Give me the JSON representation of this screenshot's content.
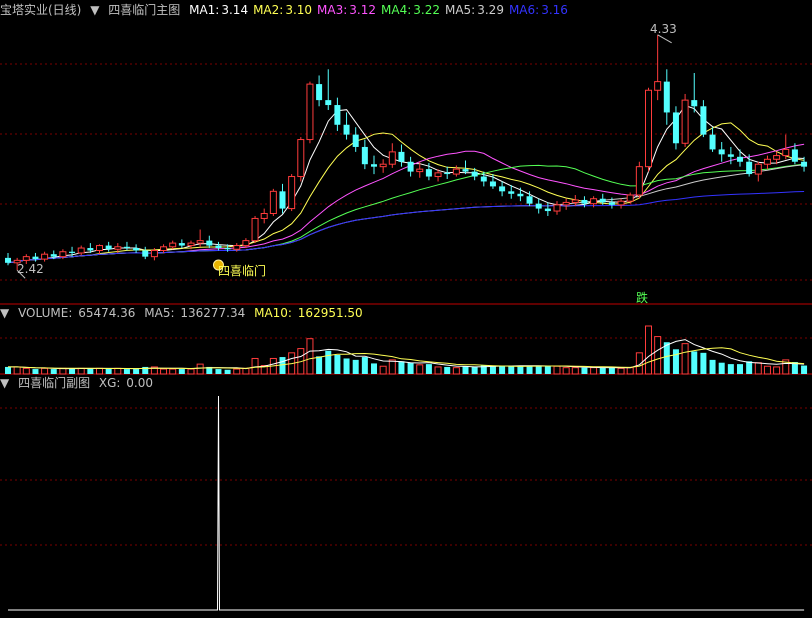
{
  "main_header": {
    "stock": "宝塔实业(日线)",
    "indicator": "四喜临门主图",
    "ma": [
      {
        "label": "MA1:",
        "value": "3.14",
        "color": "#ffffff"
      },
      {
        "label": "MA2:",
        "value": "3.10",
        "color": "#ffff54"
      },
      {
        "label": "MA3:",
        "value": "3.12",
        "color": "#ff54ff"
      },
      {
        "label": "MA4:",
        "value": "3.22",
        "color": "#54ff54"
      },
      {
        "label": "MA5:",
        "value": "3.29",
        "color": "#cccccc"
      },
      {
        "label": "MA6:",
        "value": "3.16",
        "color": "#3333ff"
      }
    ]
  },
  "volume_header": {
    "title": "VOLUME:",
    "value": "65474.36",
    "ma5_label": "MA5:",
    "ma5_value": "136277.34",
    "ma10_label": "MA10:",
    "ma10_value": "162951.50"
  },
  "sub_header": {
    "title": "四喜临门副图",
    "xg_label": "XG:",
    "xg_value": "0.00"
  },
  "annotations": {
    "high_label": "4.33",
    "low_label": "2.42",
    "signal_label": "四喜临门",
    "drop_label": "跌"
  },
  "colors": {
    "up": "#ff3c3c",
    "down": "#54ffff",
    "grid": "#7a0000",
    "separator": "#c00000",
    "text": "#c0c0c0",
    "ma1": "#ffffff",
    "ma2": "#ffff54",
    "ma3": "#ff54ff",
    "ma4": "#54ff54",
    "ma5": "#cccccc",
    "ma6": "#3333ff"
  },
  "chart_data": [
    {
      "type": "candlestick",
      "title": "四喜临门主图",
      "ylim": [
        2.3,
        4.45
      ],
      "max_high": 4.33,
      "min_low": 2.42,
      "ohlc": [
        [
          2.52,
          2.56,
          2.46,
          2.48
        ],
        [
          2.48,
          2.52,
          2.42,
          2.5
        ],
        [
          2.5,
          2.55,
          2.47,
          2.53
        ],
        [
          2.53,
          2.56,
          2.49,
          2.51
        ],
        [
          2.51,
          2.57,
          2.49,
          2.55
        ],
        [
          2.55,
          2.58,
          2.51,
          2.53
        ],
        [
          2.53,
          2.59,
          2.51,
          2.57
        ],
        [
          2.57,
          2.61,
          2.53,
          2.56
        ],
        [
          2.56,
          2.62,
          2.54,
          2.6
        ],
        [
          2.6,
          2.64,
          2.56,
          2.58
        ],
        [
          2.58,
          2.63,
          2.55,
          2.62
        ],
        [
          2.62,
          2.65,
          2.57,
          2.59
        ],
        [
          2.59,
          2.64,
          2.56,
          2.61
        ],
        [
          2.61,
          2.65,
          2.58,
          2.6
        ],
        [
          2.6,
          2.63,
          2.56,
          2.58
        ],
        [
          2.58,
          2.61,
          2.51,
          2.53
        ],
        [
          2.53,
          2.6,
          2.5,
          2.58
        ],
        [
          2.58,
          2.63,
          2.56,
          2.61
        ],
        [
          2.61,
          2.66,
          2.59,
          2.64
        ],
        [
          2.64,
          2.67,
          2.6,
          2.62
        ],
        [
          2.62,
          2.66,
          2.59,
          2.64
        ],
        [
          2.64,
          2.75,
          2.61,
          2.66
        ],
        [
          2.66,
          2.7,
          2.6,
          2.62
        ],
        [
          2.62,
          2.65,
          2.58,
          2.6
        ],
        [
          2.6,
          2.63,
          2.57,
          2.59
        ],
        [
          2.59,
          2.64,
          2.57,
          2.62
        ],
        [
          2.62,
          2.68,
          2.6,
          2.66
        ],
        [
          2.66,
          2.86,
          2.64,
          2.84
        ],
        [
          2.84,
          2.92,
          2.8,
          2.88
        ],
        [
          2.88,
          3.08,
          2.86,
          3.06
        ],
        [
          3.06,
          3.12,
          2.88,
          2.92
        ],
        [
          2.92,
          3.2,
          2.9,
          3.18
        ],
        [
          3.18,
          3.5,
          3.14,
          3.48
        ],
        [
          3.48,
          3.95,
          3.45,
          3.93
        ],
        [
          3.93,
          4.0,
          3.75,
          3.8
        ],
        [
          3.8,
          4.05,
          3.72,
          3.76
        ],
        [
          3.76,
          3.82,
          3.55,
          3.6
        ],
        [
          3.6,
          3.7,
          3.48,
          3.52
        ],
        [
          3.52,
          3.58,
          3.38,
          3.42
        ],
        [
          3.42,
          3.48,
          3.24,
          3.28
        ],
        [
          3.28,
          3.35,
          3.2,
          3.26
        ],
        [
          3.26,
          3.32,
          3.21,
          3.28
        ],
        [
          3.28,
          3.45,
          3.25,
          3.38
        ],
        [
          3.38,
          3.44,
          3.26,
          3.3
        ],
        [
          3.3,
          3.34,
          3.18,
          3.22
        ],
        [
          3.22,
          3.3,
          3.17,
          3.24
        ],
        [
          3.24,
          3.29,
          3.15,
          3.18
        ],
        [
          3.18,
          3.24,
          3.14,
          3.21
        ],
        [
          3.21,
          3.26,
          3.16,
          3.2
        ],
        [
          3.2,
          3.27,
          3.18,
          3.24
        ],
        [
          3.24,
          3.31,
          3.2,
          3.22
        ],
        [
          3.22,
          3.25,
          3.15,
          3.18
        ],
        [
          3.18,
          3.22,
          3.1,
          3.14
        ],
        [
          3.14,
          3.2,
          3.08,
          3.1
        ],
        [
          3.1,
          3.14,
          3.02,
          3.06
        ],
        [
          3.06,
          3.11,
          3.0,
          3.04
        ],
        [
          3.04,
          3.09,
          2.98,
          3.02
        ],
        [
          3.02,
          3.06,
          2.94,
          2.96
        ],
        [
          2.96,
          3.0,
          2.88,
          2.92
        ],
        [
          2.92,
          2.97,
          2.86,
          2.9
        ],
        [
          2.9,
          2.98,
          2.87,
          2.95
        ],
        [
          2.95,
          3.0,
          2.91,
          2.97
        ],
        [
          2.97,
          3.03,
          2.94,
          2.99
        ],
        [
          2.99,
          3.02,
          2.93,
          2.96
        ],
        [
          2.96,
          3.02,
          2.93,
          3.0
        ],
        [
          3.0,
          3.04,
          2.95,
          2.97
        ],
        [
          2.97,
          3.01,
          2.92,
          2.95
        ],
        [
          2.95,
          3.0,
          2.92,
          2.98
        ],
        [
          2.98,
          3.05,
          2.96,
          3.03
        ],
        [
          3.03,
          3.3,
          3.0,
          3.26
        ],
        [
          3.26,
          3.9,
          3.22,
          3.88
        ],
        [
          3.88,
          4.33,
          3.8,
          3.95
        ],
        [
          3.95,
          4.05,
          3.6,
          3.7
        ],
        [
          3.7,
          3.75,
          3.4,
          3.45
        ],
        [
          3.45,
          3.85,
          3.42,
          3.8
        ],
        [
          3.8,
          4.02,
          3.7,
          3.75
        ],
        [
          3.75,
          3.8,
          3.5,
          3.52
        ],
        [
          3.52,
          3.58,
          3.38,
          3.4
        ],
        [
          3.4,
          3.46,
          3.3,
          3.36
        ],
        [
          3.36,
          3.42,
          3.28,
          3.34
        ],
        [
          3.34,
          3.4,
          3.26,
          3.3
        ],
        [
          3.3,
          3.36,
          3.18,
          3.2
        ],
        [
          3.2,
          3.3,
          3.14,
          3.28
        ],
        [
          3.28,
          3.35,
          3.24,
          3.32
        ],
        [
          3.32,
          3.38,
          3.28,
          3.35
        ],
        [
          3.35,
          3.52,
          3.32,
          3.4
        ],
        [
          3.4,
          3.45,
          3.28,
          3.3
        ],
        [
          3.3,
          3.34,
          3.22,
          3.26
        ]
      ],
      "ma_values": {
        "MA1": 3.14,
        "MA2": 3.1,
        "MA3": 3.12,
        "MA4": 3.22,
        "MA5": 3.29,
        "MA6": 3.16
      }
    },
    {
      "type": "bar",
      "title": "VOLUME",
      "last_value": 65474.36,
      "ma5_last": 136277.34,
      "ma10_last": 162951.5
    },
    {
      "type": "line",
      "title": "四喜临门副图",
      "series": [
        {
          "name": "XG",
          "last_value": 0.0
        }
      ]
    }
  ]
}
